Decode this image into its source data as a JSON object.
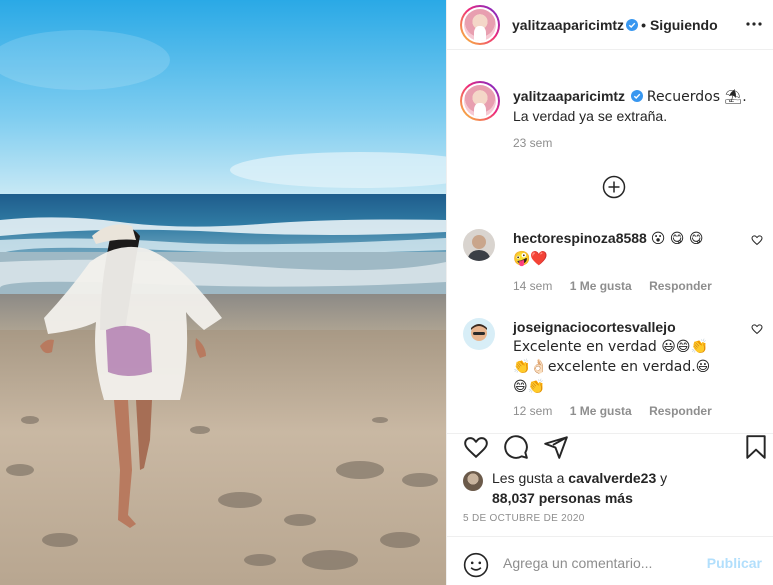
{
  "header": {
    "username": "yalitzaaparicimtz",
    "separator": "•",
    "follow_status": "Siguiendo"
  },
  "caption": {
    "username": "yalitzaaparicimtz",
    "text_line1": "Recuerdos ⛱.",
    "text_line2": "La verdad ya se extraña.",
    "time": "23 sem"
  },
  "comments": [
    {
      "username": "hectorespinoza8588",
      "emoji_line1": "😮 😋 😋",
      "emoji_line2": "🤪❤️",
      "time": "14 sem",
      "likes": "1 Me gusta",
      "reply": "Responder"
    },
    {
      "username": "joseignaciocortesvallejo",
      "line1": "Excelente en verdad 😃😄👏",
      "line2": "👏👌🏻excelente en verdad.😃",
      "line3": "😄👏",
      "time": "12 sem",
      "likes": "1 Me gusta",
      "reply": "Responder"
    }
  ],
  "likes": {
    "prefix": "Les gusta a ",
    "user": "cavalverde23",
    "mid": " y",
    "count_text": "88,037 personas más"
  },
  "post_date": "5 DE OCTUBRE DE 2020",
  "add_comment": {
    "placeholder": "Agrega un comentario...",
    "publish_label": "Publicar"
  },
  "icons": {
    "verified": "verified-badge-icon",
    "more": "more-options-icon",
    "load_more": "plus-circle-icon",
    "like": "heart-icon",
    "comment": "comment-icon",
    "share": "paper-plane-icon",
    "save": "bookmark-icon",
    "emoji": "emoji-face-icon"
  },
  "colors": {
    "verified_blue": "#3897f0",
    "publish_disabled": "#b2dffc",
    "secondary_text": "#8e8e8e"
  }
}
